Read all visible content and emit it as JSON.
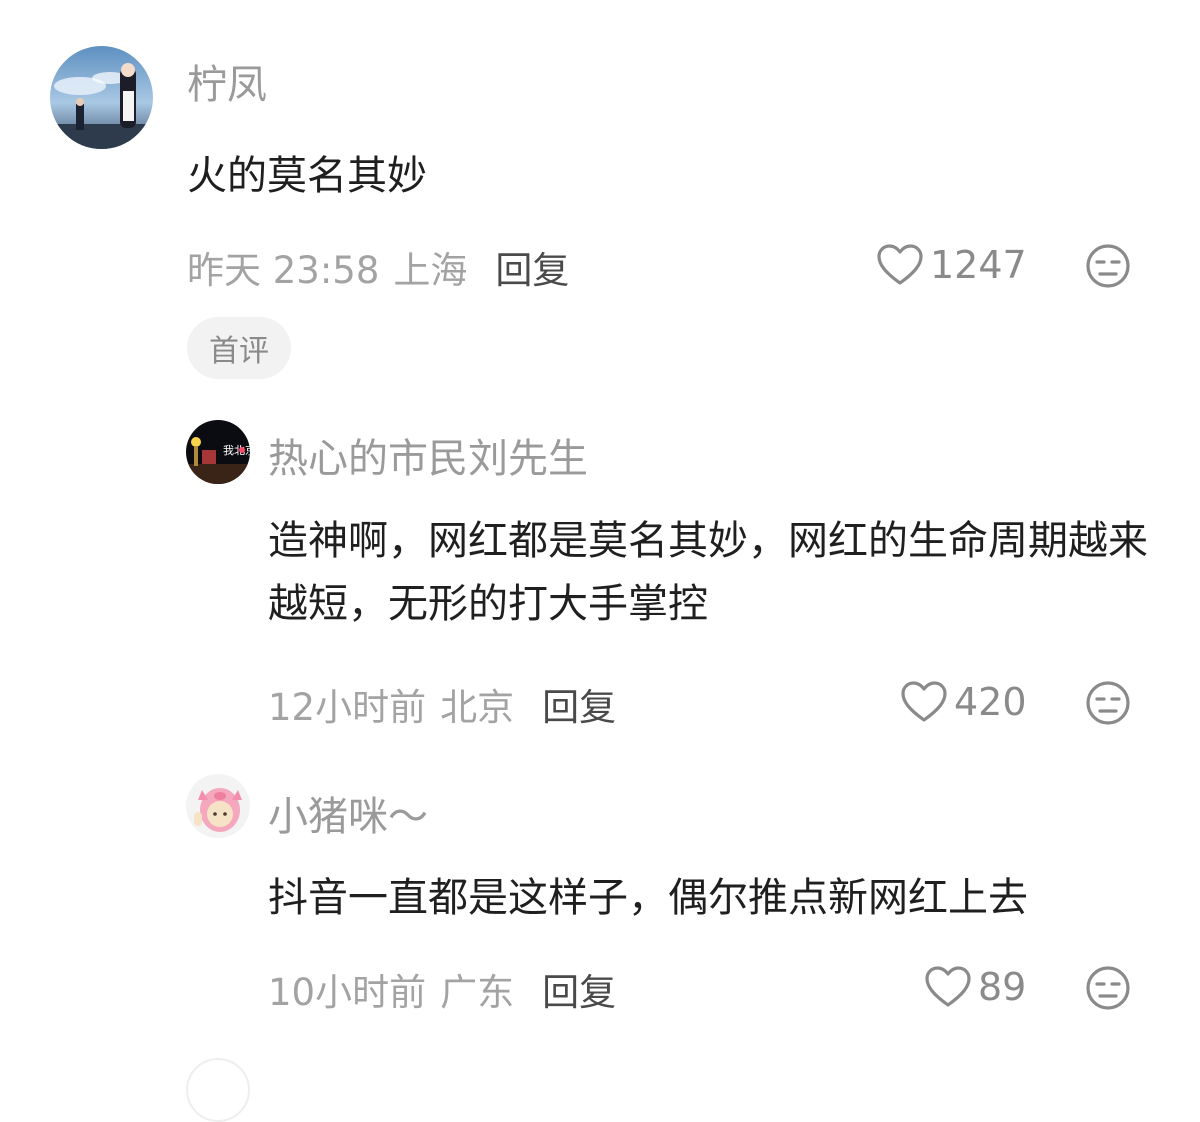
{
  "comments": [
    {
      "username": "柠凤",
      "text": "火的莫名其妙",
      "time": "昨天 23:58",
      "location": "上海",
      "reply_label": "回复",
      "likes": "1247",
      "badge": "首评"
    }
  ],
  "replies": [
    {
      "username": "热心的市民刘先生",
      "text": "造神啊，网红都是莫名其妙，网红的生命周期越来越短，无形的打大手掌控",
      "time": "12小时前",
      "location": "北京",
      "reply_label": "回复",
      "likes": "420",
      "avatar_text": "我北京"
    },
    {
      "username": "小猪咪～",
      "text": "抖音一直都是这样子，偶尔推点新网红上去",
      "time": "10小时前",
      "location": "广东",
      "reply_label": "回复",
      "likes": "89"
    }
  ],
  "icons": {
    "like": "heart-outline-icon",
    "dislike": "unamused-face-icon"
  },
  "colors": {
    "username": "#9a9a9a",
    "text": "#1f1f1f",
    "meta": "#a3a3a3",
    "badge_bg": "#f2f2f2"
  }
}
